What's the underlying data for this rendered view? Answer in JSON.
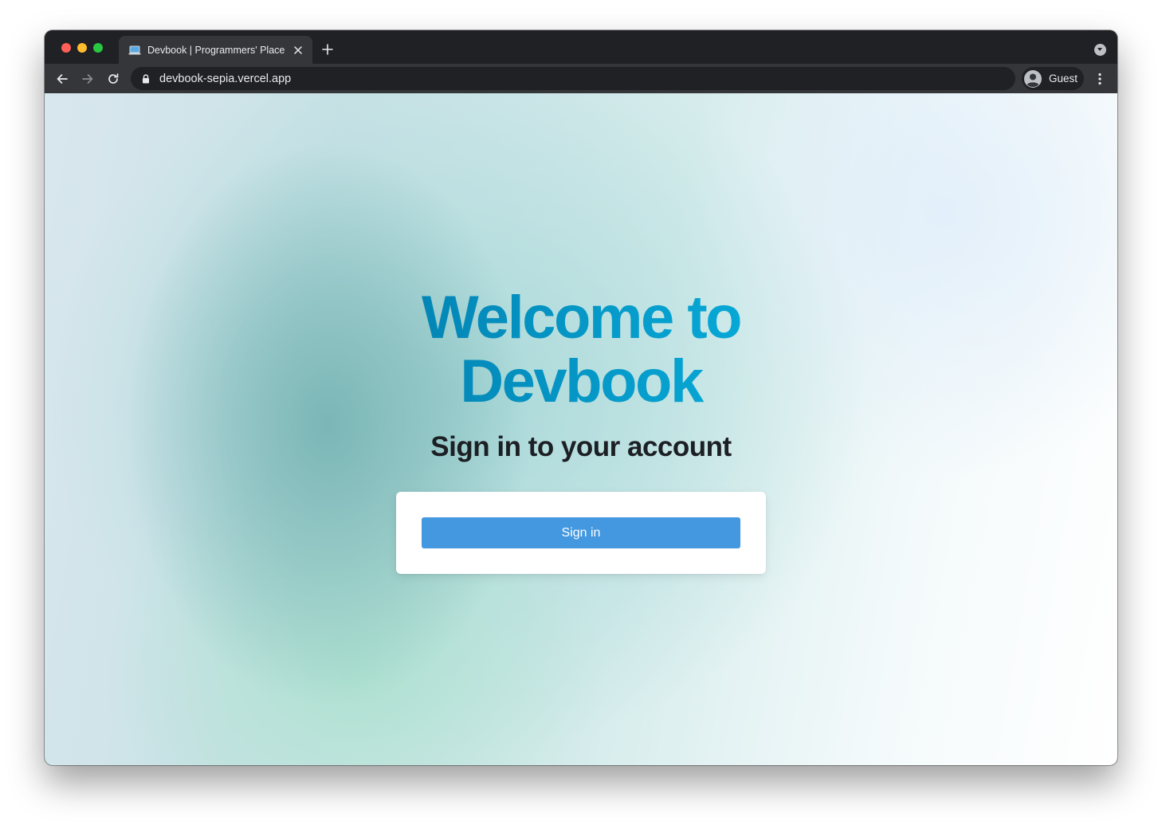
{
  "browser": {
    "tab": {
      "title": "Devbook | Programmers' Place",
      "favicon": "laptop-icon",
      "close_glyph": "✕"
    },
    "new_tab_icon": "plus-icon",
    "url": "devbook-sepia.vercel.app",
    "profile": {
      "name": "Guest",
      "icon": "avatar-icon"
    },
    "colors": {
      "frame": "#202124",
      "toolbar": "#35363a",
      "text": "#e8eaed"
    }
  },
  "page": {
    "title_line1": "Welcome to",
    "title_line2": "Devbook",
    "subtitle": "Sign in to your account",
    "signin_label": "Sign in",
    "colors": {
      "title_gradient_start": "#0386b6",
      "title_gradient_end": "#07a8d6",
      "subtitle": "#1c1f24",
      "button": "#4398e0",
      "button_text": "#ffffff"
    }
  }
}
